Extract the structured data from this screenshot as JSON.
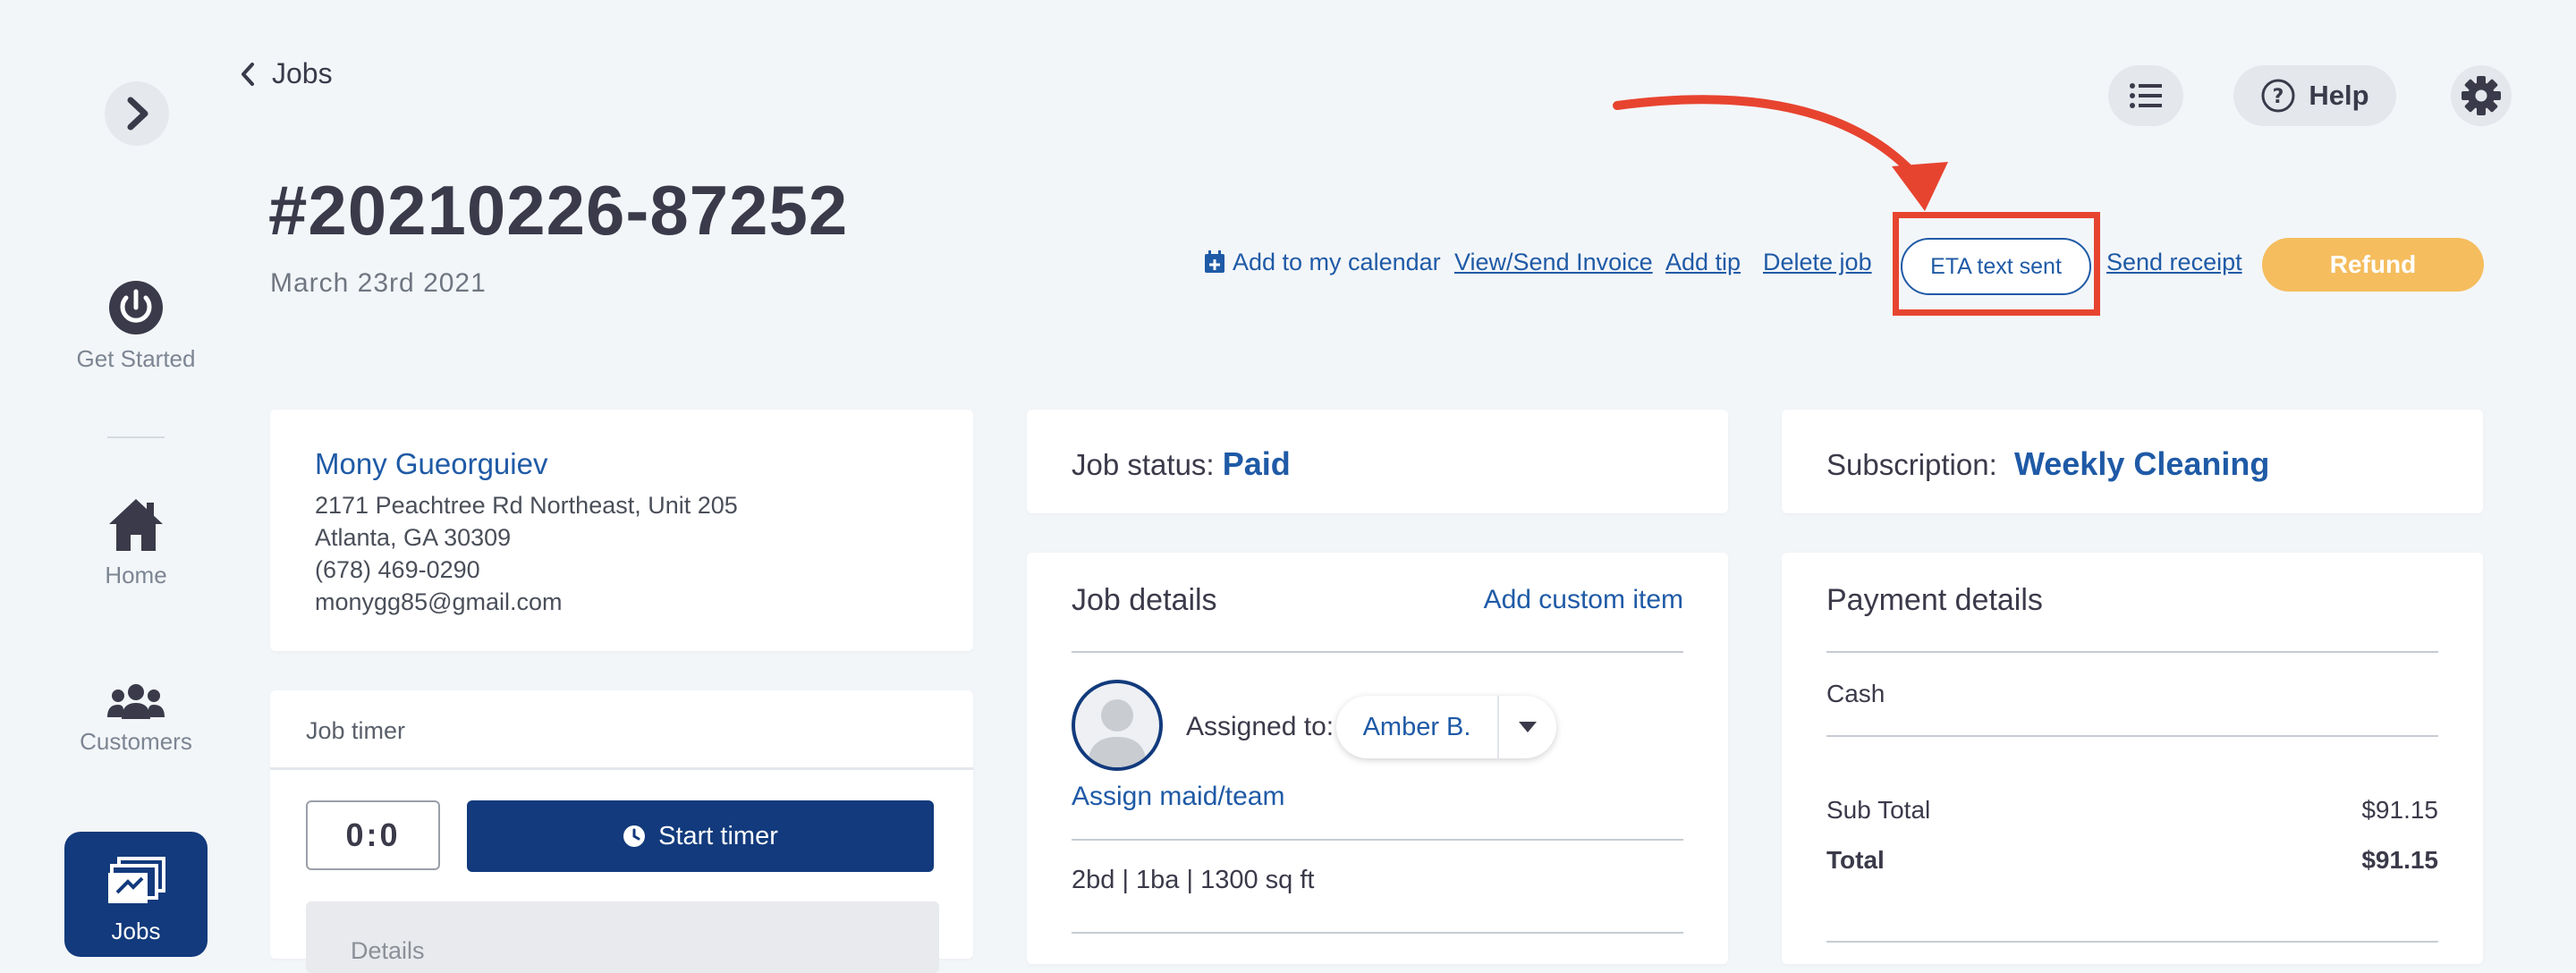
{
  "sidebar": {
    "items": [
      {
        "label": "Get Started",
        "icon": "power-icon"
      },
      {
        "label": "Home",
        "icon": "home-icon"
      },
      {
        "label": "Customers",
        "icon": "users-icon"
      },
      {
        "label": "Jobs",
        "icon": "jobs-icon",
        "active": true
      }
    ]
  },
  "header": {
    "back_label": "Jobs",
    "help_label": "Help",
    "job_number": "#20210226-87252",
    "job_date": "March 23rd 2021"
  },
  "actions": {
    "add_calendar": "Add to my calendar",
    "view_invoice": "View/Send Invoice",
    "add_tip": "Add tip",
    "delete_job": "Delete job",
    "eta_text": "ETA text sent",
    "send_receipt": "Send receipt",
    "refund": "Refund"
  },
  "customer": {
    "name": "Mony Gueorguiev",
    "address_line1": "2171 Peachtree Rd Northeast, Unit 205",
    "address_line2": "Atlanta, GA 30309",
    "phone": "(678) 469-0290",
    "email": "monygg85@gmail.com"
  },
  "timer": {
    "title": "Job timer",
    "value": "0:0",
    "start_label": "Start timer",
    "details_label": "Details"
  },
  "job_status": {
    "label": "Job status:",
    "value": "Paid"
  },
  "job_details": {
    "title": "Job details",
    "add_custom_item": "Add custom item",
    "assigned_label": "Assigned to:",
    "assigned_value": "Amber B.",
    "assign_link": "Assign maid/team",
    "specs": "2bd | 1ba | 1300 sq ft"
  },
  "subscription": {
    "label": "Subscription:",
    "value": "Weekly Cleaning"
  },
  "payment": {
    "title": "Payment details",
    "method": "Cash",
    "subtotal_label": "Sub Total",
    "subtotal_value": "$91.15",
    "total_label": "Total",
    "total_value": "$91.15"
  },
  "colors": {
    "accent": "#1f5aa6",
    "nav_active": "#123a7c",
    "refund": "#f5bd5e",
    "highlight": "#e74430"
  }
}
